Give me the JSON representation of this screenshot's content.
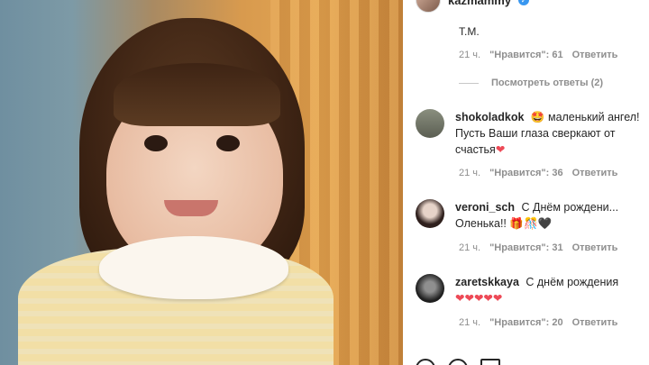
{
  "header": {
    "username": "kazmammy",
    "verified_symbol": "✓"
  },
  "top_comment": {
    "snippet": "Т.М.",
    "time": "21 ч.",
    "likes": "\"Нравится\": 61",
    "reply": "Ответить"
  },
  "view_replies": "Посмотреть ответы (2)",
  "comments": [
    {
      "user": "shokoladkok",
      "emoji": "🤩",
      "text": "маленький ангел! Пусть Ваши глаза сверкают от счастья",
      "trail": "❤",
      "time": "21 ч.",
      "likes": "\"Нравится\": 36",
      "reply": "Ответить",
      "avatar_color": "#6b6e60"
    },
    {
      "user": "veroni_sch",
      "text": "С Днём рождени... Оленька!!",
      "trail": "🎁🎊🖤",
      "time": "21 ч.",
      "likes": "\"Нравится\": 31",
      "reply": "Ответить",
      "avatar_color": "#4a3a36"
    },
    {
      "user": "zaretskkaya",
      "text": "С днём рождения",
      "trail": "❤❤❤❤❤",
      "time": "21 ч.",
      "likes": "\"Нравится\": 20",
      "reply": "Ответить",
      "avatar_color": "#3a3a3a"
    }
  ]
}
